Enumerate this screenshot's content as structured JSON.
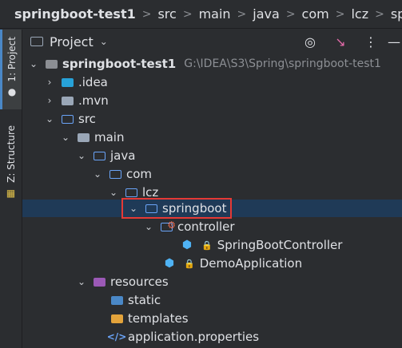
{
  "breadcrumb": [
    "springboot-test1",
    "main",
    "java",
    "com",
    "lcz",
    "springboot"
  ],
  "stripe": {
    "project_tab": "1: Project",
    "structure_tab": "Z: Structure"
  },
  "pane": {
    "title": "Project"
  },
  "tree": {
    "root_name": "springboot-test1",
    "root_path": "G:\\IDEA\\S3\\Spring\\springboot-test1",
    "idea": ".idea",
    "mvn": ".mvn",
    "src": "src",
    "main": "main",
    "java": "java",
    "com": "com",
    "lcz": "lcz",
    "springboot": "springboot",
    "controller": "controller",
    "controller_class": "SpringBootController",
    "demo_app": "DemoApplication",
    "resources": "resources",
    "static": "static",
    "templates": "templates",
    "app_props": "application.properties"
  },
  "colors": {
    "background": "#2b2d30",
    "selection": "#1f3a57",
    "highlight_box": "#e53935",
    "folder_blue": "#6aa4f8"
  }
}
